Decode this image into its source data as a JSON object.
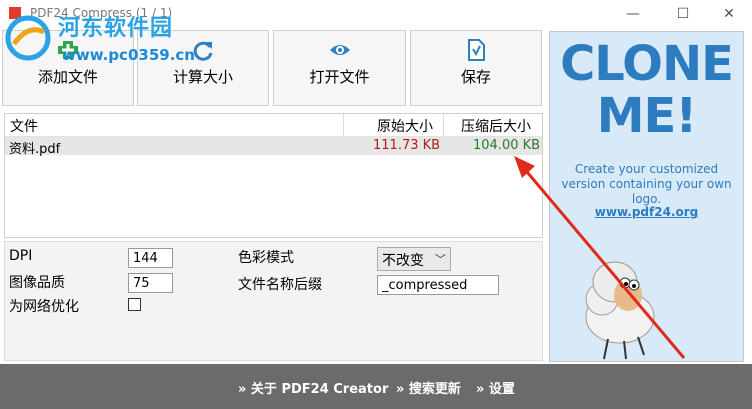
{
  "window": {
    "title": "PDF24 Compress (1 / 1)",
    "minimize_glyph": "—",
    "maximize_glyph": "☐",
    "close_glyph": "✕"
  },
  "watermark": {
    "title": "河东软件园",
    "url": "www.pc0359.cn",
    "icon": "hedong-logo"
  },
  "toolbar": {
    "add_files_label": "添加文件",
    "add_files_icon": "add-file-icon",
    "calculate_size_label": "计算大小",
    "calculate_size_icon": "refresh-icon",
    "open_file_label": "打开文件",
    "open_file_icon": "eye-icon",
    "save_label": "保存",
    "save_icon": "save-document-icon"
  },
  "file_list": {
    "columns": [
      "文件",
      "原始大小",
      "压缩后大小"
    ],
    "rows": [
      {
        "name": "资料.pdf",
        "original_size": "111.73 KB",
        "compressed_size": "104.00 KB"
      }
    ],
    "original_size_color": "#b31b1b",
    "compressed_size_color": "#2a7a2a"
  },
  "options": {
    "dpi_label": "DPI",
    "dpi_value": "144",
    "image_quality_label": "图像品质",
    "image_quality_value": "75",
    "web_optimize_label": "为网络优化",
    "web_optimize_checked": false,
    "color_mode_label": "色彩模式",
    "color_mode_value": "不改变",
    "filename_suffix_label": "文件名称后缀",
    "filename_suffix_value": "_compressed"
  },
  "ad": {
    "line1": "CLONE",
    "line2": "ME!",
    "text": "Create your customized version containing your own logo.",
    "link": "www.pdf24.org",
    "color": "#2d7cc0"
  },
  "footer": {
    "about": "» 关于 PDF24 Creator",
    "search_updates": "» 搜索更新",
    "settings": "» 设置"
  },
  "annotation": {
    "arrow_color": "#e02a1a"
  }
}
